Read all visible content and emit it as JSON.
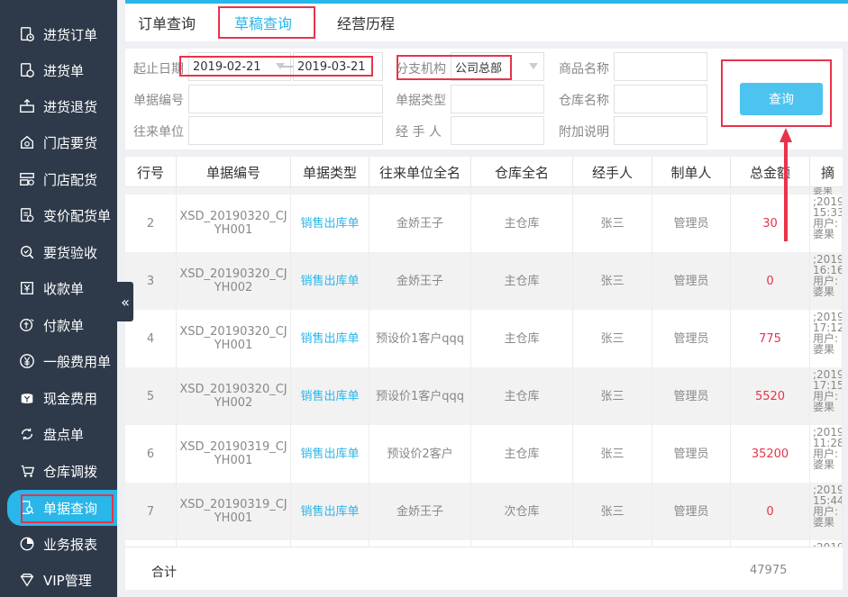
{
  "sidebar": {
    "items": [
      {
        "label": "进货订单",
        "icon": "purchase-order-icon"
      },
      {
        "label": "进货单",
        "icon": "purchase-receipt-icon"
      },
      {
        "label": "进货退货",
        "icon": "purchase-return-icon"
      },
      {
        "label": "门店要货",
        "icon": "store-request-icon"
      },
      {
        "label": "门店配货",
        "icon": "store-distribution-icon"
      },
      {
        "label": "变价配货单",
        "icon": "price-change-icon"
      },
      {
        "label": "要货验收",
        "icon": "acceptance-icon"
      },
      {
        "label": "收款单",
        "icon": "receipt-icon"
      },
      {
        "label": "付款单",
        "icon": "payment-icon"
      },
      {
        "label": "一般费用单",
        "icon": "yen-icon"
      },
      {
        "label": "现金费用",
        "icon": "cash-icon"
      },
      {
        "label": "盘点单",
        "icon": "inventory-icon"
      },
      {
        "label": "仓库调拨",
        "icon": "transfer-icon"
      },
      {
        "label": "单据查询",
        "icon": "document-search-icon",
        "active": true
      },
      {
        "label": "业务报表",
        "icon": "pie-chart-icon"
      },
      {
        "label": "VIP管理",
        "icon": "vip-icon"
      }
    ]
  },
  "tabs": [
    {
      "label": "订单查询"
    },
    {
      "label": "草稿查询",
      "active": true
    },
    {
      "label": "经营历程"
    }
  ],
  "filters": {
    "date_label": "起止日期",
    "date_start": "2019-02-21",
    "date_sep": "—",
    "date_end": "2019-03-21",
    "branch_label": "分支机构",
    "branch_value": "公司总部",
    "product_label": "商品名称",
    "doc_no_label": "单据编号",
    "doc_type_label": "单据类型",
    "warehouse_label": "仓库名称",
    "partner_label": "往来单位",
    "handler_label": "经 手 人",
    "note_label": "附加说明",
    "query_button": "查询"
  },
  "table": {
    "headers": [
      "行号",
      "单据编号",
      "单据类型",
      "往来单位全名",
      "仓库全名",
      "经手人",
      "制单人",
      "总金额",
      "摘"
    ],
    "top_partial_note": "婆果",
    "rows": [
      {
        "no": "2",
        "doc_no": "XSD_20190320_CJ\nYH001",
        "type": "销售出库单",
        "partner": "金娇王子",
        "warehouse": "主仓库",
        "handler": "张三",
        "maker": "管理员",
        "amount": "30",
        "note": ";2019\n15:33:\n用户:\n婆果"
      },
      {
        "no": "3",
        "doc_no": "XSD_20190320_CJ\nYH002",
        "type": "销售出库单",
        "partner": "金娇王子",
        "warehouse": "主仓库",
        "handler": "张三",
        "maker": "管理员",
        "amount": "0",
        "note": ";2019\n16:16:\n用户:\n婆果"
      },
      {
        "no": "4",
        "doc_no": "XSD_20190320_CJ\nYH001",
        "type": "销售出库单",
        "partner": "预设价1客户qqq",
        "warehouse": "主仓库",
        "handler": "张三",
        "maker": "管理员",
        "amount": "775",
        "note": ";2019\n17:12:\n用户:\n婆果"
      },
      {
        "no": "5",
        "doc_no": "XSD_20190320_CJ\nYH002",
        "type": "销售出库单",
        "partner": "预设价1客户qqq",
        "warehouse": "主仓库",
        "handler": "张三",
        "maker": "管理员",
        "amount": "5520",
        "note": ";2019\n17:15:\n用户:\n婆果"
      },
      {
        "no": "6",
        "doc_no": "XSD_20190319_CJ\nYH001",
        "type": "销售出库单",
        "partner": "预设价2客户",
        "warehouse": "主仓库",
        "handler": "张三",
        "maker": "管理员",
        "amount": "35200",
        "note": ";2019\n11:28:\n用户:\n婆果"
      },
      {
        "no": "7",
        "doc_no": "XSD_20190319_CJ\nYH001",
        "type": "销售出库单",
        "partner": "金娇王子",
        "warehouse": "次仓库",
        "handler": "张三",
        "maker": "管理员",
        "amount": "0",
        "note": ";2019\n15:44:\n用户:\n婆果"
      }
    ],
    "bottom_partial_note": ";2019"
  },
  "footer": {
    "total_label": "合计",
    "total_value": "47975"
  },
  "colors": {
    "sidebar_bg": "#2e3a4a",
    "accent": "#29b6e8",
    "amount": "#e8334a",
    "annotation": "#e8334a"
  }
}
